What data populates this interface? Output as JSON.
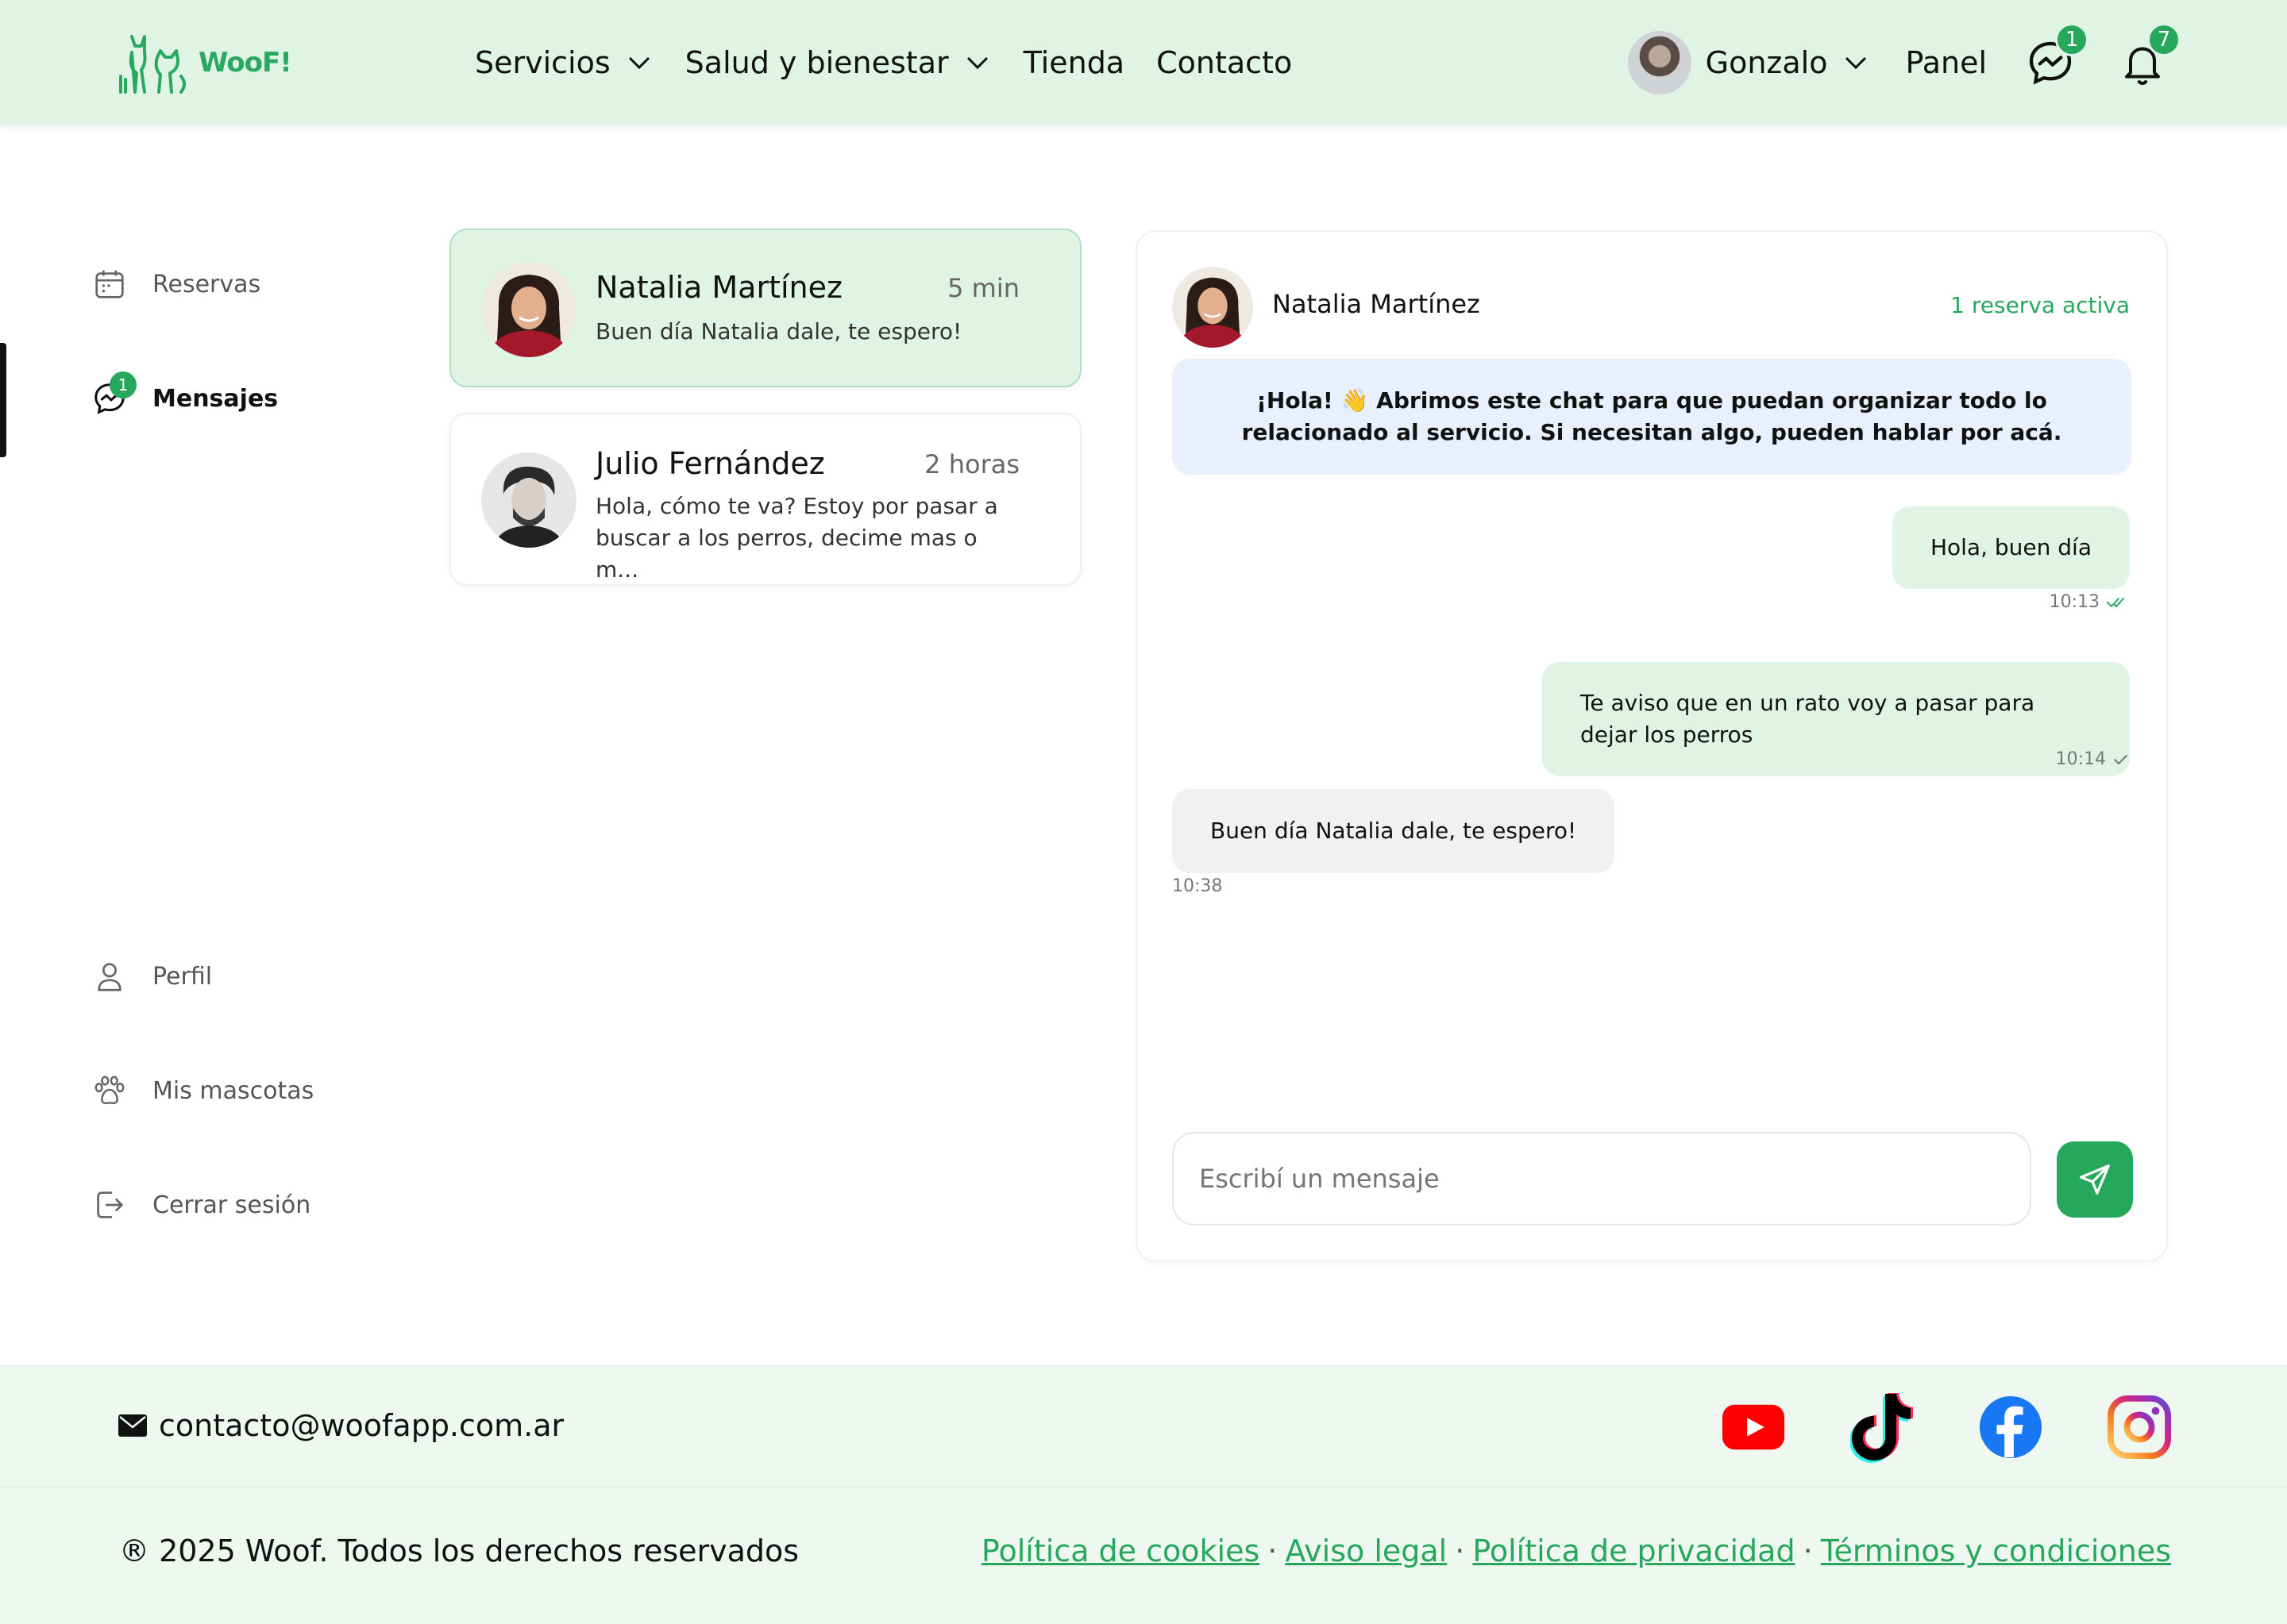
{
  "header": {
    "logo_text": "WooF!",
    "nav": [
      {
        "label": "Servicios"
      },
      {
        "label": "Salud y bienestar"
      },
      {
        "label": "Tienda"
      },
      {
        "label": "Contacto"
      }
    ],
    "user_name": "Gonzalo",
    "panel_label": "Panel",
    "messages_badge": "1",
    "notifications_badge": "7"
  },
  "sidebar": {
    "items": [
      {
        "label": "Reservas",
        "icon": "calendar-icon"
      },
      {
        "label": "Mensajes",
        "icon": "chat-icon",
        "badge": "1"
      },
      {
        "label": "Perfil",
        "icon": "user-icon"
      },
      {
        "label": "Mis mascotas",
        "icon": "paw-icon"
      },
      {
        "label": "Cerrar sesión",
        "icon": "logout-icon"
      }
    ]
  },
  "conversations": [
    {
      "name": "Natalia Martínez",
      "time": "5 min",
      "preview": "Buen día Natalia dale, te espero!"
    },
    {
      "name": "Julio Fernández",
      "time": "2 horas",
      "preview": "Hola, cómo te va? Estoy por pasar a buscar a los perros, decime mas o m..."
    }
  ],
  "chat": {
    "contact_name": "Natalia Martínez",
    "status": "1 reserva activa",
    "system_message": "¡Hola! 👋 Abrimos este chat para que puedan organizar todo lo relacionado al servicio. Si necesitan algo, pueden hablar por acá.",
    "messages": [
      {
        "text": "Hola, buen día",
        "time": "10:13",
        "direction": "out",
        "read": true
      },
      {
        "text": "Te aviso que en un rato voy a pasar para dejar los perros",
        "time": "10:14",
        "direction": "out",
        "read": false
      },
      {
        "text": "Buen día Natalia dale, te espero!",
        "time": "10:38",
        "direction": "in"
      }
    ],
    "input_placeholder": "Escribí un mensaje"
  },
  "footer": {
    "email": "contacto@woofapp.com.ar",
    "socials": [
      "youtube-icon",
      "tiktok-icon",
      "facebook-icon",
      "instagram-icon"
    ],
    "copyright": "® 2025 Woof. Todos los derechos reservados",
    "links": [
      "Política de cookies",
      "Aviso legal",
      "Política de privacidad",
      "Términos y condiciones"
    ],
    "separator": "·"
  },
  "colors": {
    "brand_green": "#26a85c",
    "header_bg": "#e0f4e6",
    "system_bubble": "#e8f0fe"
  }
}
